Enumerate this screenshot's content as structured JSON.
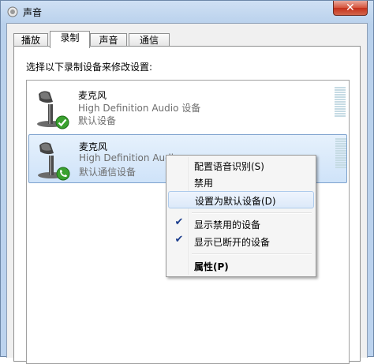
{
  "window": {
    "title": "声音",
    "close_glyph": "✕"
  },
  "tabs": [
    {
      "label": "播放"
    },
    {
      "label": "录制",
      "active": true
    },
    {
      "label": "声音"
    },
    {
      "label": "通信"
    }
  ],
  "recording": {
    "instruction": "选择以下录制设备来修改设置:",
    "devices": [
      {
        "name": "麦克风",
        "driver": "High Definition Audio 设备",
        "status": "默认设备",
        "badge": "check-icon"
      },
      {
        "name": "麦克风",
        "driver": "High Definition Audio",
        "status": "默认通信设备",
        "badge": "phone-icon",
        "selected": true
      }
    ]
  },
  "context_menu": {
    "items": [
      {
        "label": "配置语音识别(S)"
      },
      {
        "label": "禁用"
      },
      {
        "label": "设置为默认设备(D)"
      },
      {
        "label": "显示禁用的设备",
        "checked": true
      },
      {
        "label": "显示已断开的设备",
        "checked": true
      },
      {
        "label": "属性(P)"
      }
    ],
    "check_glyph": "✔"
  }
}
